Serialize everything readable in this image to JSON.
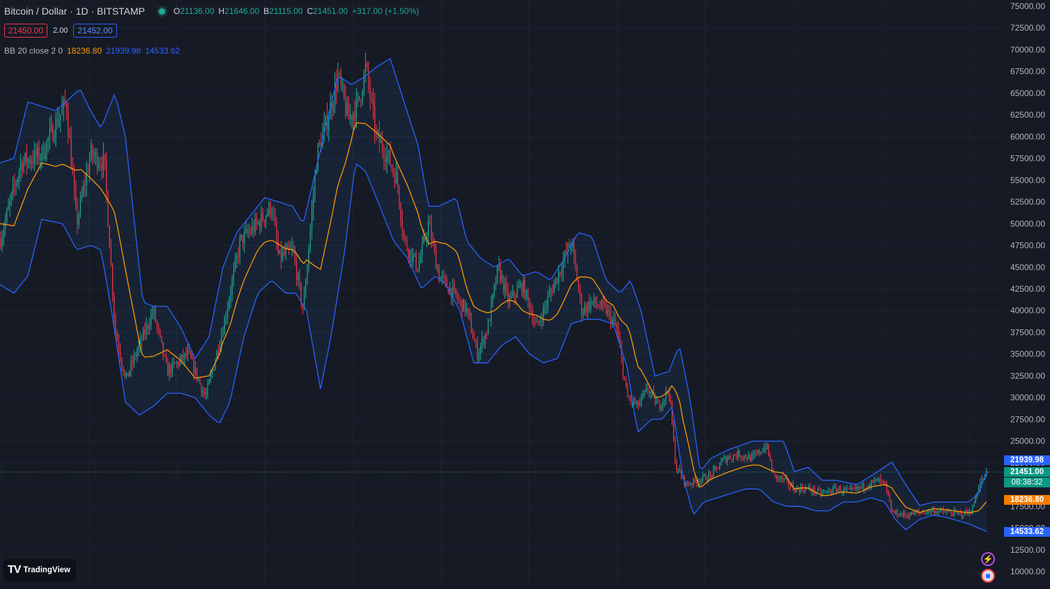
{
  "header": {
    "symbol": "Bitcoin / Dollar · 1D · BITSTAMP",
    "o_label": "O",
    "o_value": "21136.00",
    "h_label": "H",
    "h_value": "21646.00",
    "l_label": "B",
    "l_value": "21115.00",
    "c_label": "C",
    "c_value": "21451.00",
    "change": "+317.00 (+1.50%)"
  },
  "trade": {
    "sell": "21450.00",
    "spread": "2.00",
    "buy": "21452.00"
  },
  "indicator": {
    "name": "BB 20 close 2 0",
    "basis": "18236.80",
    "upper": "21939.98",
    "lower": "14533.62"
  },
  "price_labels": {
    "upper": "21939.98",
    "last": "21451.00",
    "countdown": "08:38:32",
    "basis": "18236.80",
    "lower": "14533.62"
  },
  "brand": {
    "name": "TradingView"
  },
  "colors": {
    "bg": "#161a25",
    "up": "#22ab94",
    "down": "#f23645",
    "band": "#2962ff",
    "basis": "#ff9800"
  },
  "chart_data": {
    "type": "candlestick",
    "title": "Bitcoin / Dollar · 1D · BITSTAMP",
    "ylim": [
      10000,
      75000
    ],
    "y_ticks": [
      "75000.00",
      "72500.00",
      "70000.00",
      "67500.00",
      "65000.00",
      "62500.00",
      "60000.00",
      "57500.00",
      "55000.00",
      "52500.00",
      "50000.00",
      "47500.00",
      "45000.00",
      "42500.00",
      "40000.00",
      "37500.00",
      "35000.00",
      "32500.00",
      "30000.00",
      "27500.00",
      "25000.00",
      "22500.00",
      "20000.00",
      "17500.00",
      "15000.00",
      "12500.00",
      "10000.00"
    ],
    "close_path": [
      [
        0,
        48000
      ],
      [
        30,
        57000
      ],
      [
        60,
        58000
      ],
      [
        95,
        64000
      ],
      [
        110,
        50000
      ],
      [
        130,
        58000
      ],
      [
        150,
        57000
      ],
      [
        165,
        38000
      ],
      [
        180,
        32000
      ],
      [
        200,
        36000
      ],
      [
        220,
        40000
      ],
      [
        240,
        33000
      ],
      [
        270,
        35000
      ],
      [
        295,
        30000
      ],
      [
        320,
        38000
      ],
      [
        345,
        48000
      ],
      [
        370,
        50000
      ],
      [
        390,
        52000
      ],
      [
        400,
        46000
      ],
      [
        420,
        47000
      ],
      [
        435,
        40000
      ],
      [
        455,
        58000
      ],
      [
        470,
        62000
      ],
      [
        485,
        67000
      ],
      [
        500,
        62000
      ],
      [
        515,
        64000
      ],
      [
        525,
        68000
      ],
      [
        540,
        60000
      ],
      [
        555,
        58000
      ],
      [
        570,
        55000
      ],
      [
        580,
        48000
      ],
      [
        600,
        45000
      ],
      [
        615,
        50000
      ],
      [
        630,
        44000
      ],
      [
        650,
        42000
      ],
      [
        670,
        40000
      ],
      [
        685,
        35000
      ],
      [
        700,
        38000
      ],
      [
        715,
        45000
      ],
      [
        730,
        41000
      ],
      [
        750,
        43000
      ],
      [
        770,
        38000
      ],
      [
        790,
        42000
      ],
      [
        810,
        46000
      ],
      [
        820,
        48000
      ],
      [
        835,
        40000
      ],
      [
        850,
        41000
      ],
      [
        870,
        40000
      ],
      [
        885,
        38000
      ],
      [
        900,
        30000
      ],
      [
        915,
        29000
      ],
      [
        930,
        31000
      ],
      [
        945,
        29000
      ],
      [
        960,
        31000
      ],
      [
        970,
        22000
      ],
      [
        985,
        20000
      ],
      [
        1000,
        20500
      ],
      [
        1020,
        21000
      ],
      [
        1040,
        23000
      ],
      [
        1060,
        23500
      ],
      [
        1080,
        23000
      ],
      [
        1100,
        24500
      ],
      [
        1110,
        21000
      ],
      [
        1125,
        20500
      ],
      [
        1140,
        19500
      ],
      [
        1160,
        19500
      ],
      [
        1180,
        19000
      ],
      [
        1200,
        19500
      ],
      [
        1220,
        19200
      ],
      [
        1240,
        19800
      ],
      [
        1260,
        20500
      ],
      [
        1270,
        20000
      ],
      [
        1280,
        16800
      ],
      [
        1300,
        16500
      ],
      [
        1320,
        16800
      ],
      [
        1340,
        17000
      ],
      [
        1360,
        16800
      ],
      [
        1380,
        16600
      ],
      [
        1395,
        17000
      ],
      [
        1405,
        20000
      ],
      [
        1418,
        21451
      ]
    ],
    "upper_band_path": [
      [
        0,
        57000
      ],
      [
        20,
        57500
      ],
      [
        40,
        64000
      ],
      [
        80,
        63000
      ],
      [
        115,
        65500
      ],
      [
        130,
        63000
      ],
      [
        145,
        61000
      ],
      [
        165,
        65000
      ],
      [
        180,
        60000
      ],
      [
        205,
        41000
      ],
      [
        220,
        40500
      ],
      [
        240,
        40500
      ],
      [
        260,
        38000
      ],
      [
        280,
        34500
      ],
      [
        300,
        37000
      ],
      [
        320,
        45000
      ],
      [
        340,
        49000
      ],
      [
        360,
        51000
      ],
      [
        380,
        53000
      ],
      [
        400,
        52500
      ],
      [
        420,
        52000
      ],
      [
        435,
        50000
      ],
      [
        450,
        55000
      ],
      [
        470,
        62000
      ],
      [
        485,
        67000
      ],
      [
        505,
        66000
      ],
      [
        525,
        67000
      ],
      [
        540,
        68000
      ],
      [
        560,
        69000
      ],
      [
        580,
        64000
      ],
      [
        600,
        59000
      ],
      [
        615,
        52000
      ],
      [
        630,
        52000
      ],
      [
        655,
        53000
      ],
      [
        670,
        48000
      ],
      [
        690,
        46000
      ],
      [
        710,
        45000
      ],
      [
        730,
        46000
      ],
      [
        750,
        44000
      ],
      [
        770,
        44500
      ],
      [
        790,
        43500
      ],
      [
        810,
        46000
      ],
      [
        830,
        49000
      ],
      [
        850,
        48500
      ],
      [
        870,
        43500
      ],
      [
        890,
        42000
      ],
      [
        905,
        43500
      ],
      [
        920,
        40000
      ],
      [
        940,
        32500
      ],
      [
        960,
        33000
      ],
      [
        975,
        36000
      ],
      [
        990,
        30000
      ],
      [
        1005,
        21500
      ],
      [
        1020,
        23000
      ],
      [
        1045,
        24000
      ],
      [
        1080,
        25000
      ],
      [
        1100,
        25000
      ],
      [
        1125,
        25000
      ],
      [
        1140,
        21500
      ],
      [
        1160,
        22000
      ],
      [
        1180,
        20500
      ],
      [
        1200,
        20500
      ],
      [
        1230,
        20000
      ],
      [
        1260,
        21500
      ],
      [
        1280,
        22600
      ],
      [
        1300,
        20000
      ],
      [
        1320,
        17600
      ],
      [
        1340,
        18000
      ],
      [
        1360,
        18000
      ],
      [
        1390,
        18000
      ],
      [
        1405,
        19000
      ],
      [
        1418,
        21940
      ]
    ],
    "lower_band_path": [
      [
        0,
        43000
      ],
      [
        20,
        42000
      ],
      [
        40,
        44000
      ],
      [
        60,
        50500
      ],
      [
        90,
        50000
      ],
      [
        110,
        47000
      ],
      [
        130,
        47500
      ],
      [
        145,
        47000
      ],
      [
        160,
        40000
      ],
      [
        180,
        29500
      ],
      [
        200,
        28000
      ],
      [
        220,
        29000
      ],
      [
        240,
        30500
      ],
      [
        260,
        30500
      ],
      [
        280,
        30000
      ],
      [
        300,
        28000
      ],
      [
        315,
        27000
      ],
      [
        330,
        29500
      ],
      [
        350,
        37000
      ],
      [
        370,
        42000
      ],
      [
        390,
        43500
      ],
      [
        410,
        42000
      ],
      [
        425,
        42000
      ],
      [
        440,
        40000
      ],
      [
        460,
        31000
      ],
      [
        475,
        37000
      ],
      [
        495,
        47000
      ],
      [
        510,
        57000
      ],
      [
        525,
        56000
      ],
      [
        545,
        52000
      ],
      [
        565,
        48000
      ],
      [
        585,
        46000
      ],
      [
        605,
        42500
      ],
      [
        625,
        44000
      ],
      [
        640,
        43000
      ],
      [
        660,
        40000
      ],
      [
        680,
        34000
      ],
      [
        700,
        34000
      ],
      [
        720,
        36000
      ],
      [
        740,
        37000
      ],
      [
        760,
        35000
      ],
      [
        780,
        34000
      ],
      [
        800,
        34500
      ],
      [
        820,
        38500
      ],
      [
        840,
        39000
      ],
      [
        860,
        39000
      ],
      [
        880,
        38500
      ],
      [
        900,
        33500
      ],
      [
        915,
        26000
      ],
      [
        935,
        27500
      ],
      [
        950,
        27500
      ],
      [
        965,
        29000
      ],
      [
        980,
        21000
      ],
      [
        995,
        16500
      ],
      [
        1010,
        18000
      ],
      [
        1030,
        18500
      ],
      [
        1050,
        19000
      ],
      [
        1070,
        19500
      ],
      [
        1090,
        19500
      ],
      [
        1110,
        18000
      ],
      [
        1130,
        17500
      ],
      [
        1150,
        17500
      ],
      [
        1170,
        17000
      ],
      [
        1190,
        17000
      ],
      [
        1210,
        18000
      ],
      [
        1230,
        18000
      ],
      [
        1250,
        18500
      ],
      [
        1270,
        18000
      ],
      [
        1285,
        16000
      ],
      [
        1300,
        14800
      ],
      [
        1320,
        16000
      ],
      [
        1340,
        16500
      ],
      [
        1360,
        16200
      ],
      [
        1390,
        15500
      ],
      [
        1405,
        15000
      ],
      [
        1418,
        14534
      ]
    ],
    "last_price": 21451.0,
    "upper_value": 21939.98,
    "basis_value": 18236.8,
    "lower_value": 14533.62
  }
}
